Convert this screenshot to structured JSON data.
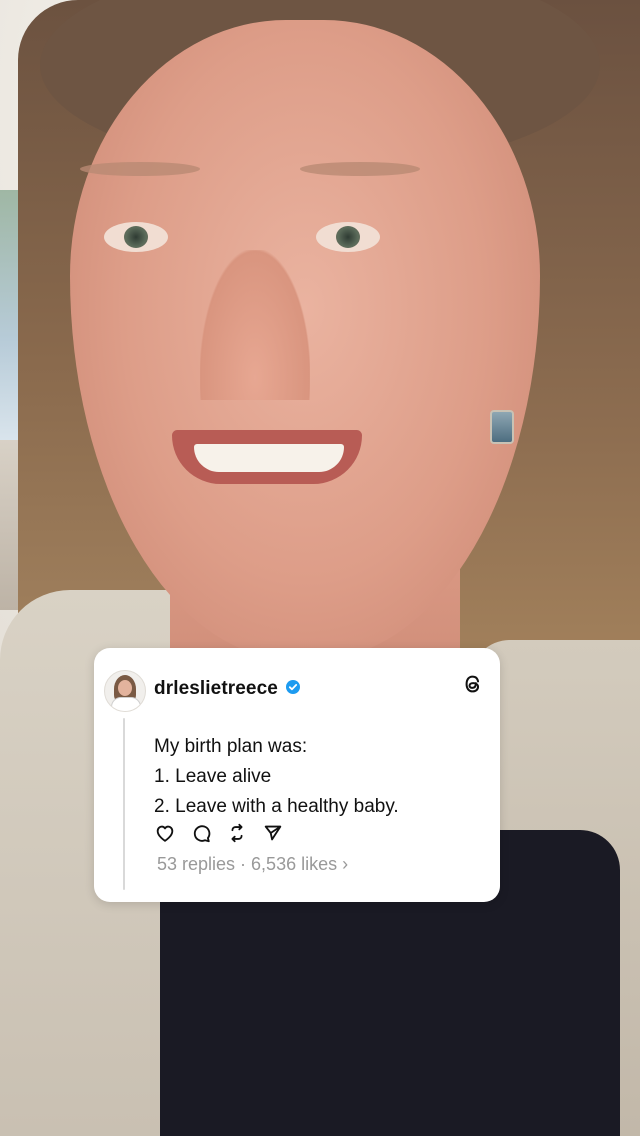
{
  "post": {
    "username": "drleslietreece",
    "verified": true,
    "text": {
      "line1": "My birth plan was:",
      "line2": "1. Leave alive",
      "line3": "2. Leave with a healthy baby."
    },
    "actions": [
      "heart-icon",
      "comment-icon",
      "repost-icon",
      "share-icon"
    ],
    "stats": {
      "replies": "53 replies",
      "separator": " · ",
      "likes": "6,536 likes",
      "chevron": "›"
    }
  },
  "brand_icon": "threads-icon",
  "colors": {
    "verified_badge": "#1d9bf0",
    "card_bg": "#ffffff",
    "stats_text": "#999999"
  }
}
